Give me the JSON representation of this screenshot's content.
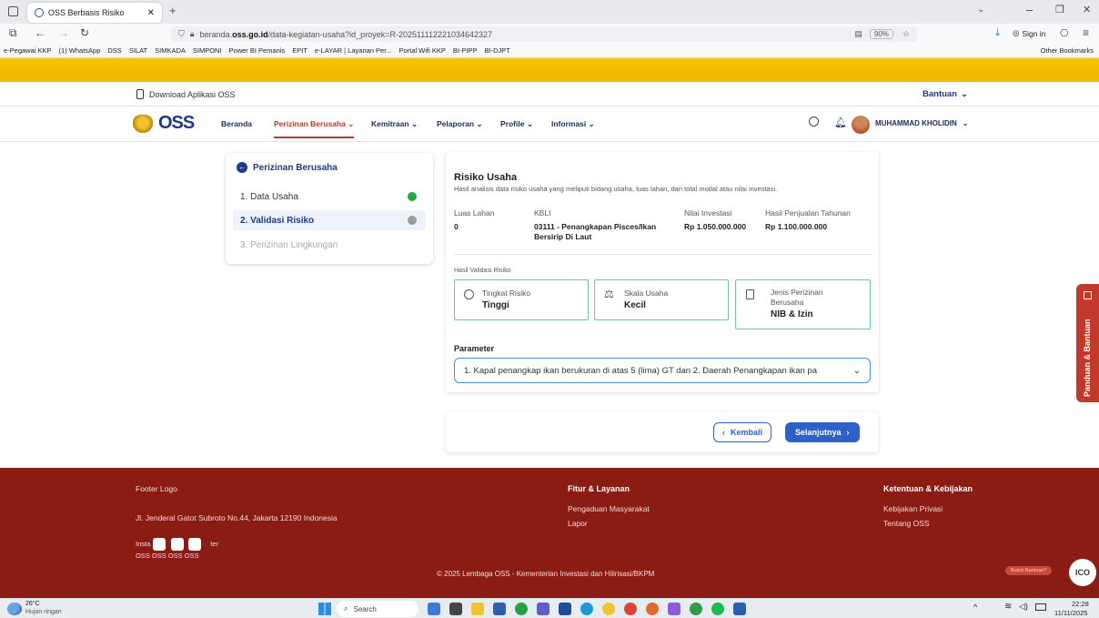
{
  "browser": {
    "tab_title": "OSS Berbasis Risiko",
    "url_prefix": "beranda.",
    "url_domain": "oss.go.id",
    "url_path": "/data-kegiatan-usaha?id_proyek=R-202511112221034642327",
    "zoom": "90%",
    "sign_in": "Sign in",
    "other_bookmarks": "Other Bookmarks",
    "bookmarks": [
      "e-Pegawai KKP",
      "(1) WhatsApp",
      "DSS",
      "SILAT",
      "SIMKADA",
      "SIMPONI",
      "Power BI Pemanis",
      "EPIT",
      "e-LAYAR | Layanan Per...",
      "Portal Wifi KKP",
      "BI-PIPP",
      "BI-DJPT"
    ]
  },
  "topbar": {
    "download_label": "Download Aplikasi OSS",
    "help_label": "Bantuan"
  },
  "nav": {
    "logo_text": "OSS",
    "items": [
      "Beranda",
      "Perizinan Berusaha",
      "Kemitraan",
      "Pelaporan",
      "Profile",
      "Informasi"
    ],
    "user_name": "MUHAMMAD KHOLIDIN"
  },
  "stepper": {
    "title": "Perizinan Berusaha",
    "steps": [
      "1. Data Usaha",
      "2. Validasi Risiko",
      "3. Perizinan Lingkungan"
    ]
  },
  "risk": {
    "title": "Risiko Usaha",
    "subtitle": "Hasil analisis data risiko usaha yang meliputi bidang usaha, luas lahan, dan total modal atau nilai investasi.",
    "headers": [
      "Luas Lahan",
      "KBLI",
      "Nilai Investasi",
      "Hasil Penjualan Tahunan"
    ],
    "values": [
      "0",
      "03111 - Penangkapan Pisces/Ikan Bersirip Di Laut",
      "Rp 1.050.000.000",
      "Rp 1.100.000.000"
    ],
    "validation_label": "Hasil Validasi Risiko",
    "boxes": [
      {
        "label": "Tingkat Risiko",
        "value": "Tinggi"
      },
      {
        "label": "Skala Usaha",
        "value": "Kecil"
      },
      {
        "label": "Jenis Perizinan Berusaha",
        "value": "NIB & Izin"
      }
    ],
    "param_label": "Parameter",
    "param_value": "1. Kapal penangkap ikan berukuran di atas 5 (lima) GT dan 2. Daerah Penangkapan ikan pa"
  },
  "buttons": {
    "back": "Kembali",
    "next": "Selanjutnya"
  },
  "side_tab": "Panduan & Bantuan",
  "footer": {
    "logo": "Footer Logo",
    "address": "Jl. Jenderal Gatot Subroto No.44, Jakarta 12190 Indonesia",
    "social_line1": "Insta",
    "social_line1_tail": "ter",
    "social_line2": "OSS OSS OSS OSS",
    "fitur_title": "Fitur & Layanan",
    "fitur_items": [
      "Pengaduan Masyarakat",
      "Lapor"
    ],
    "ketentuan_title": "Ketentuan & Kebijakan",
    "ketentuan_items": [
      "Kebijakan Privasi",
      "Tentang OSS"
    ],
    "copyright": "© 2025 Lembaga OSS - Kementerian Investasi dan Hilirisasi/BKPM",
    "help_bubble": "Butuh Bantuan?",
    "ico": "ICO"
  },
  "taskbar": {
    "weather_temp": "26°C",
    "weather_desc": "Hujan ringan",
    "search": "Search",
    "time": "22:28",
    "date": "11/11/2025"
  },
  "colors": {
    "brand_red": "#8b1c14",
    "active_red": "#c0392b",
    "primary_blue": "#2f5fc9",
    "navy": "#1b2a5e",
    "success_green": "#28a745"
  }
}
